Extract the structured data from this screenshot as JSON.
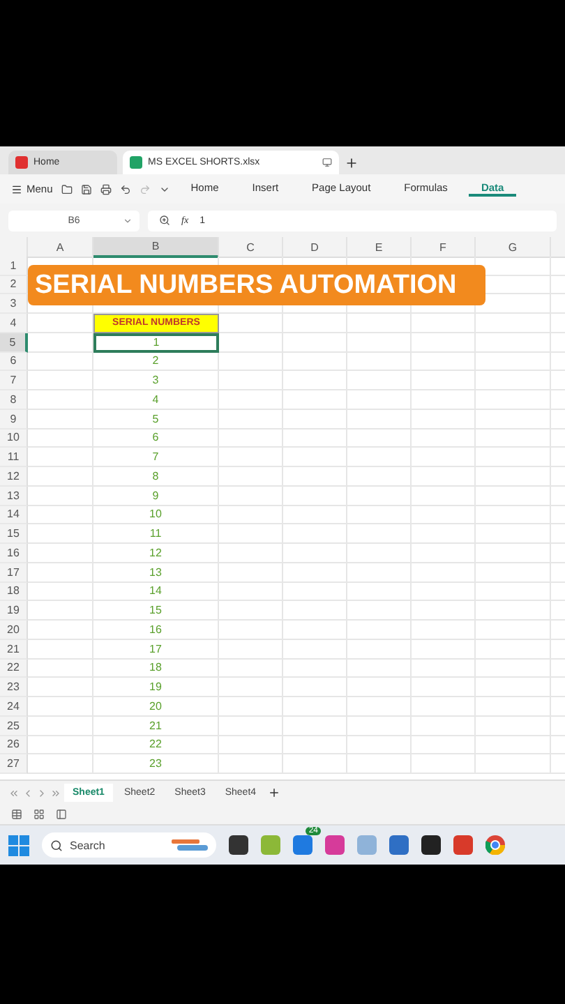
{
  "doc_tabs": [
    {
      "label": "Home",
      "kind": "home",
      "selected": false
    },
    {
      "label": "MS EXCEL SHORTS.xlsx",
      "kind": "sheet",
      "selected": true
    }
  ],
  "menu": {
    "label": "Menu"
  },
  "ribbon_tabs": [
    {
      "label": "Home",
      "selected": false
    },
    {
      "label": "Insert",
      "selected": false
    },
    {
      "label": "Page Layout",
      "selected": false
    },
    {
      "label": "Formulas",
      "selected": false
    },
    {
      "label": "Data",
      "selected": true
    }
  ],
  "formula_bar": {
    "cell": "B6",
    "fx": "fx",
    "value": "1"
  },
  "columns": [
    {
      "label": "A",
      "selected": false
    },
    {
      "label": "B",
      "selected": true
    },
    {
      "label": "C",
      "selected": false
    },
    {
      "label": "D",
      "selected": false
    },
    {
      "label": "E",
      "selected": false
    },
    {
      "label": "F",
      "selected": false
    },
    {
      "label": "G",
      "selected": false
    }
  ],
  "banner": "SERIAL NUMBERS AUTOMATION",
  "rows": [
    {
      "number": "1",
      "kind": "plain"
    },
    {
      "number": "2",
      "kind": "plain"
    },
    {
      "number": "3",
      "kind": "plain"
    },
    {
      "number": "4",
      "kind": "header",
      "b": "SERIAL NUMBERS"
    },
    {
      "number": "5",
      "kind": "value",
      "b": "1",
      "selected": true
    },
    {
      "number": "6",
      "kind": "value",
      "b": "2",
      "selected": false
    },
    {
      "number": "7",
      "kind": "value",
      "b": "3",
      "selected": false
    },
    {
      "number": "8",
      "kind": "value",
      "b": "4",
      "selected": false
    },
    {
      "number": "9",
      "kind": "value",
      "b": "5",
      "selected": false
    },
    {
      "number": "10",
      "kind": "value",
      "b": "6",
      "selected": false
    },
    {
      "number": "11",
      "kind": "value",
      "b": "7",
      "selected": false
    },
    {
      "number": "12",
      "kind": "value",
      "b": "8",
      "selected": false
    },
    {
      "number": "13",
      "kind": "value",
      "b": "9",
      "selected": false
    },
    {
      "number": "14",
      "kind": "value",
      "b": "10",
      "selected": false
    },
    {
      "number": "15",
      "kind": "value",
      "b": "11",
      "selected": false
    },
    {
      "number": "16",
      "kind": "value",
      "b": "12",
      "selected": false
    },
    {
      "number": "17",
      "kind": "value",
      "b": "13",
      "selected": false
    },
    {
      "number": "18",
      "kind": "value",
      "b": "14",
      "selected": false
    },
    {
      "number": "19",
      "kind": "value",
      "b": "15",
      "selected": false
    },
    {
      "number": "20",
      "kind": "value",
      "b": "16",
      "selected": false
    },
    {
      "number": "21",
      "kind": "value",
      "b": "17",
      "selected": false
    },
    {
      "number": "22",
      "kind": "value",
      "b": "18",
      "selected": false
    },
    {
      "number": "23",
      "kind": "value",
      "b": "19",
      "selected": false
    },
    {
      "number": "24",
      "kind": "value",
      "b": "20",
      "selected": false
    },
    {
      "number": "25",
      "kind": "value",
      "b": "21",
      "selected": false
    },
    {
      "number": "26",
      "kind": "value",
      "b": "22",
      "selected": false
    },
    {
      "number": "27",
      "kind": "value",
      "b": "23",
      "selected": false
    }
  ],
  "sheet_tabs": [
    {
      "label": "Sheet1",
      "selected": true
    },
    {
      "label": "Sheet2",
      "selected": false
    },
    {
      "label": "Sheet3",
      "selected": false
    },
    {
      "label": "Sheet4",
      "selected": false
    }
  ],
  "taskbar": {
    "search_placeholder": "Search",
    "badge": "24"
  }
}
